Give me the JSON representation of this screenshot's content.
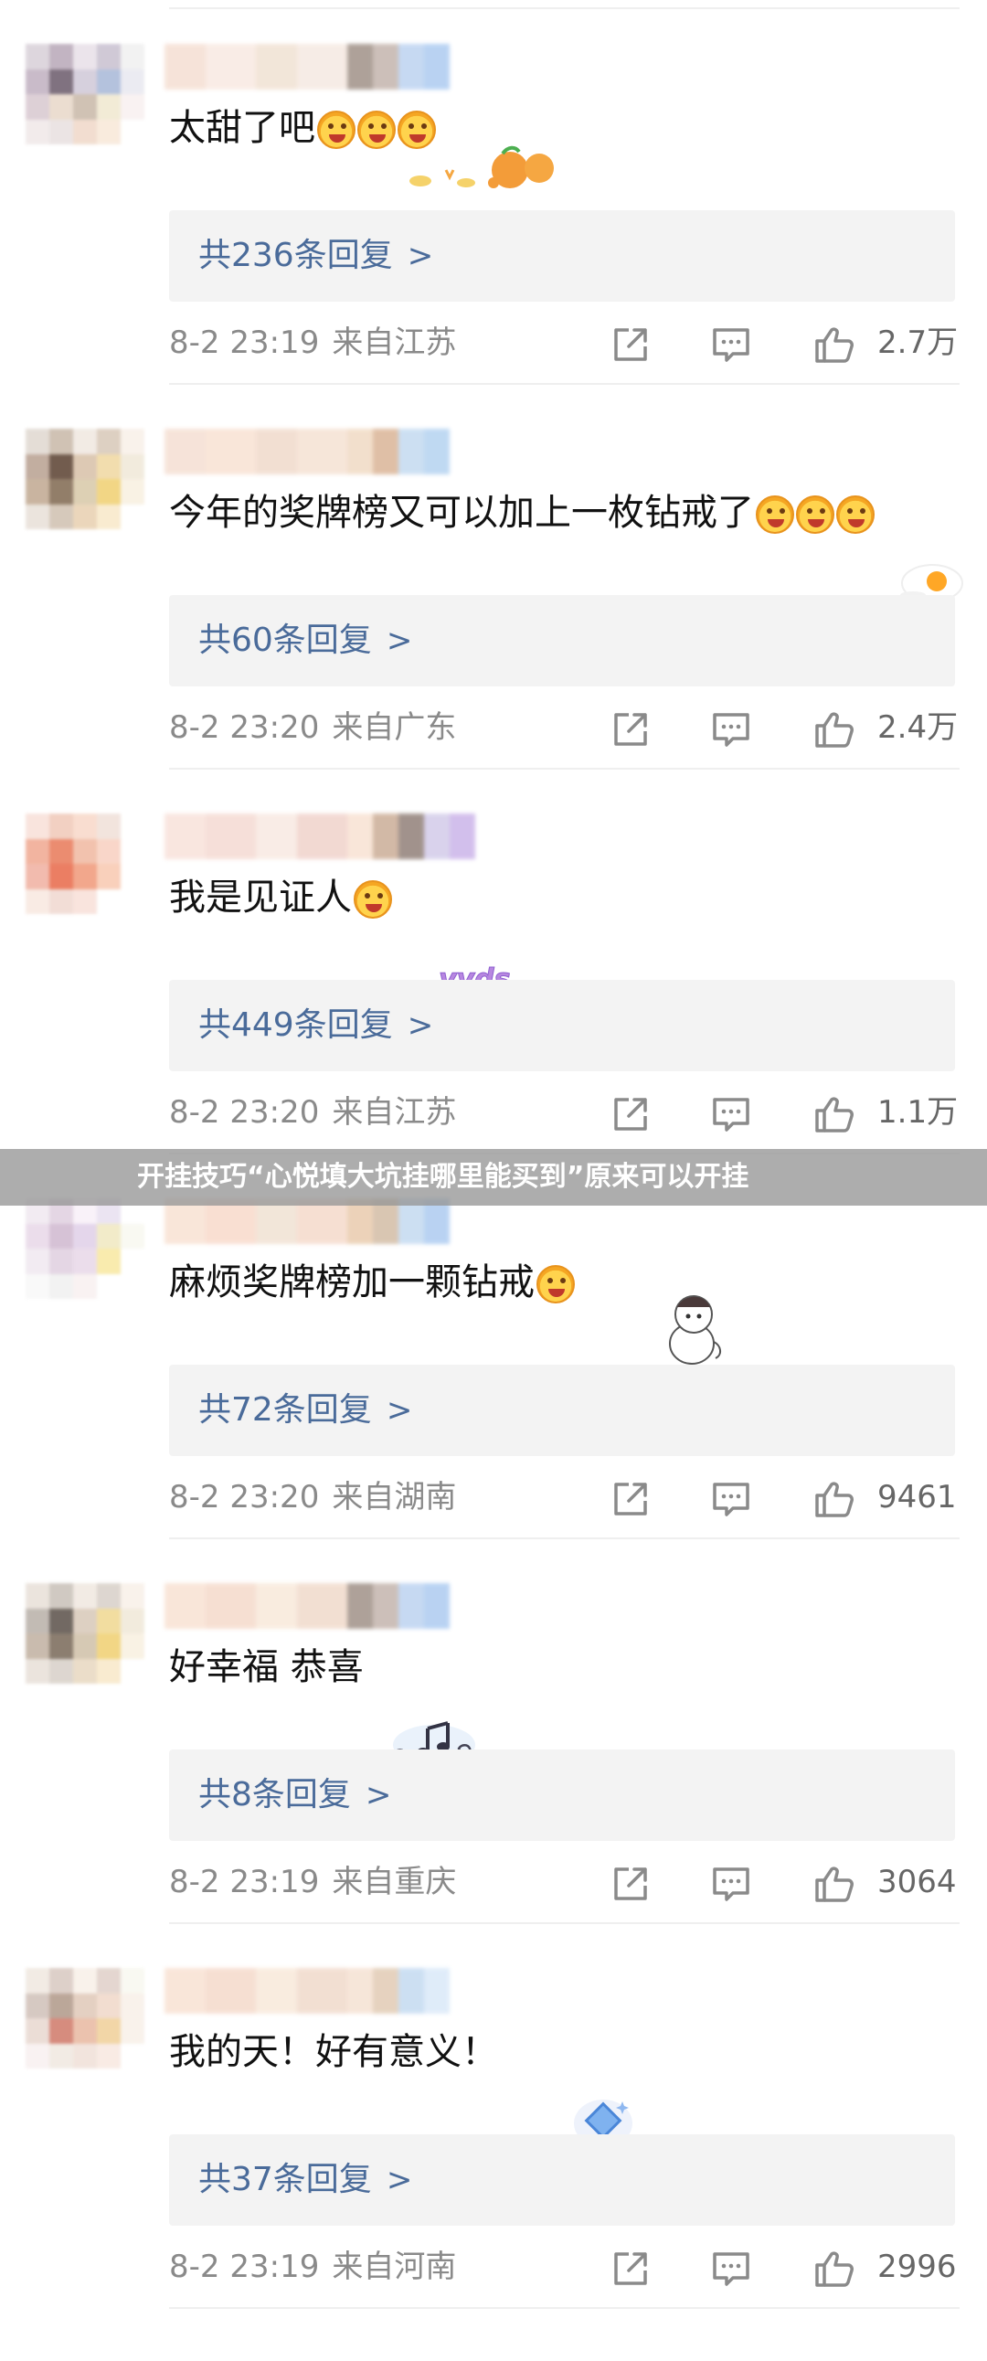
{
  "comments": [
    {
      "text": "太甜了吧",
      "emoji_count": 3,
      "sticker": "tangerine-sticker",
      "replies": "共236条回复",
      "date": "8-2 23:19",
      "location": "来自江苏",
      "likes": "2.7万",
      "avatar_colors": [
        "#d8d0d8",
        "#b8a8b8",
        "#e8e0e8",
        "#c8c0d0",
        "#f0f0f0",
        "#c0b0c0",
        "#6a5a6a",
        "#d0c8d8",
        "#a8b8d8",
        "#e8e8f0",
        "#d8c8d0",
        "#e8d8c8",
        "#c8b8a8",
        "#f0e8d0",
        "#f8f0f0",
        "#f0e8e8",
        "#e8e0e0",
        "#f0d8c8",
        "#f8e8d8",
        "#ffffff"
      ],
      "name_colors": [
        "#f5ddd0",
        "#f8e8e0",
        "#f0e0d0",
        "#f5e8e0",
        "#9a8a80",
        "#c0b0a8",
        "#b8d0f0",
        "#a8c8f0"
      ]
    },
    {
      "text": "今年的奖牌榜又可以加上一枚钻戒了",
      "emoji_count": 3,
      "sticker": "fried-egg-sticker",
      "replies": "共60条回复",
      "date": "8-2 23:20",
      "location": "来自广东",
      "likes": "2.4万",
      "avatar_colors": [
        "#e0d8d0",
        "#c8b8a8",
        "#f0e8e0",
        "#d8c8b8",
        "#f8f0e8",
        "#b8a090",
        "#5a4030",
        "#d8c0a8",
        "#f0d8a0",
        "#f0e8d8",
        "#c0a890",
        "#806850",
        "#d8c8a8",
        "#f0d070",
        "#f8f0e0",
        "#e8e0d8",
        "#d0c0b0",
        "#e8d0b0",
        "#f8e8c8",
        "#ffffff"
      ],
      "name_colors": [
        "#f5ddd0",
        "#f8e0d0",
        "#f0d8c8",
        "#f5e0d0",
        "#f0d8c0",
        "#d8b090",
        "#c0d8f0",
        "#b0d0f0"
      ]
    },
    {
      "text": "我是见证人",
      "emoji_count": 1,
      "sticker": "yyds-sticker",
      "replies": "共449条回复",
      "date": "8-2 23:20",
      "location": "来自江苏",
      "likes": "1.1万",
      "avatar_colors": [
        "#f8e0d8",
        "#f0c8b8",
        "#f8d8c8",
        "#f0e0d8",
        "#ffffff",
        "#f0a890",
        "#e87858",
        "#f0b8a0",
        "#f8d0c0",
        "#ffffff",
        "#f0b0a0",
        "#e86848",
        "#f09878",
        "#f8c8b0",
        "#ffffff",
        "#f8e8e0",
        "#f0d8d0",
        "#f8e0d8",
        "#ffffff",
        "#ffffff"
      ],
      "name_colors": [
        "#f8e0d8",
        "#f5d8d0",
        "#f8e8e0",
        "#f0d0c8",
        "#f8e0d0",
        "#c8a890",
        "#8a7870",
        "#d0c8e8",
        "#c8b0e8"
      ]
    },
    {
      "text": "麻烦奖牌榜加一颗钻戒",
      "emoji_count": 1,
      "sticker": "cat-girl-sticker",
      "replies": "共72条回复",
      "date": "8-2 23:20",
      "location": "来自湖南",
      "likes": "9461",
      "avatar_colors": [
        "#f0e8f0",
        "#e0d0e0",
        "#f8f0f8",
        "#e8e0f0",
        "#ffffff",
        "#e8d8e8",
        "#d0b8d0",
        "#e0d0e8",
        "#f0e8c0",
        "#f8f8f0",
        "#f0e8f0",
        "#e0d0e0",
        "#e8d8e8",
        "#f8e8a0",
        "#ffffff",
        "#f8f8f8",
        "#f0f0f0",
        "#f8f0f0",
        "#ffffff",
        "#ffffff"
      ],
      "name_colors": [
        "#f8e0d0",
        "#f8d8c8",
        "#f0e0d0",
        "#f5d8c8",
        "#e8c8a8",
        "#d0b8a0",
        "#c0d8f0",
        "#a8c8f0"
      ]
    },
    {
      "text": "好幸福 恭喜",
      "emoji_count": 0,
      "sticker": "music-note-sticker",
      "replies": "共8条回复",
      "date": "8-2 23:19",
      "location": "来自重庆",
      "likes": "3064",
      "avatar_colors": [
        "#e8e0d8",
        "#c8c0b8",
        "#f0e8e0",
        "#d8d0c8",
        "#f8f0e8",
        "#b8b0a8",
        "#5a5048",
        "#d8c8b8",
        "#f0d890",
        "#f0e8d8",
        "#c0b0a0",
        "#786858",
        "#d0c0a8",
        "#f0d070",
        "#f8f0e0",
        "#e8e0d8",
        "#d8d0c8",
        "#e8d8c0",
        "#f8e8c8",
        "#ffffff"
      ],
      "name_colors": [
        "#f8e0d0",
        "#f5d8c8",
        "#f8e8d8",
        "#f0d8c8",
        "#9a8a80",
        "#c0b0a8",
        "#b8d0f0",
        "#a8c8f0"
      ]
    },
    {
      "text": "我的天！好有意义！",
      "emoji_count": 0,
      "sticker": "diamond-sticker",
      "replies": "共37条回复",
      "date": "8-2 23:19",
      "location": "来自河南",
      "likes": "2996",
      "avatar_colors": [
        "#f0e8e0",
        "#d8c8c0",
        "#f8f0e8",
        "#e0d0c8",
        "#f8f8f0",
        "#d0c0b8",
        "#b09888",
        "#e0c8b8",
        "#f0d8c8",
        "#f8f0e8",
        "#e8d8d0",
        "#d07868",
        "#e8b8a0",
        "#f0d098",
        "#f8f0e8",
        "#f8f0f0",
        "#f0e8e0",
        "#f0e0d8",
        "#f8e8e0",
        "#ffffff"
      ],
      "name_colors": [
        "#f8e0d0",
        "#f5d8c8",
        "#f8e8d8",
        "#f0d8c8",
        "#f5e0d0",
        "#e0c8b0",
        "#c0d8f0",
        "#d8e8f8"
      ]
    }
  ],
  "overlay": {
    "text": "开挂技巧“心悦填大坑挂哪里能买到”原来可以开挂"
  },
  "icons": {
    "share": "share-icon",
    "comment": "comment-icon",
    "like": "thumbs-up-icon",
    "chevron": "chevron-right-icon"
  },
  "colors": {
    "reply_link": "#4a6b9a",
    "meta": "#8a8a8a",
    "reply_bg": "#f3f3f3"
  }
}
